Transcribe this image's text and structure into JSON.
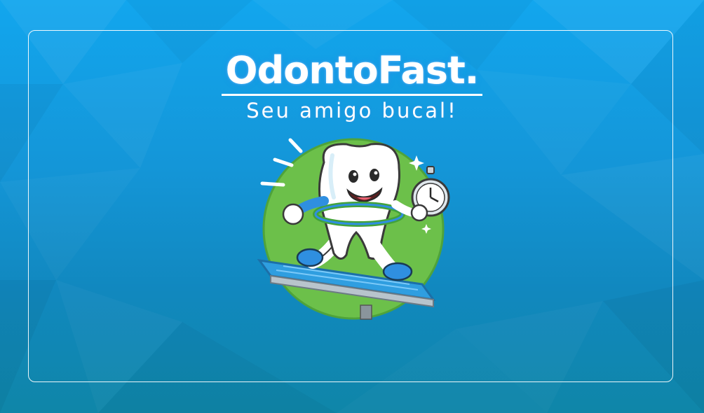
{
  "brand": {
    "title": "OdontoFast.",
    "subtitle": "Seu amigo bucal!"
  },
  "mascot": {
    "icon": "running-tooth-mascot-icon"
  },
  "colors": {
    "background_top": "#12a6ee",
    "background_bottom": "#0f86a8",
    "mascot_green": "#6cc04a",
    "treadmill_blue": "#2f9ee0",
    "frame_border": "#ffffff"
  }
}
